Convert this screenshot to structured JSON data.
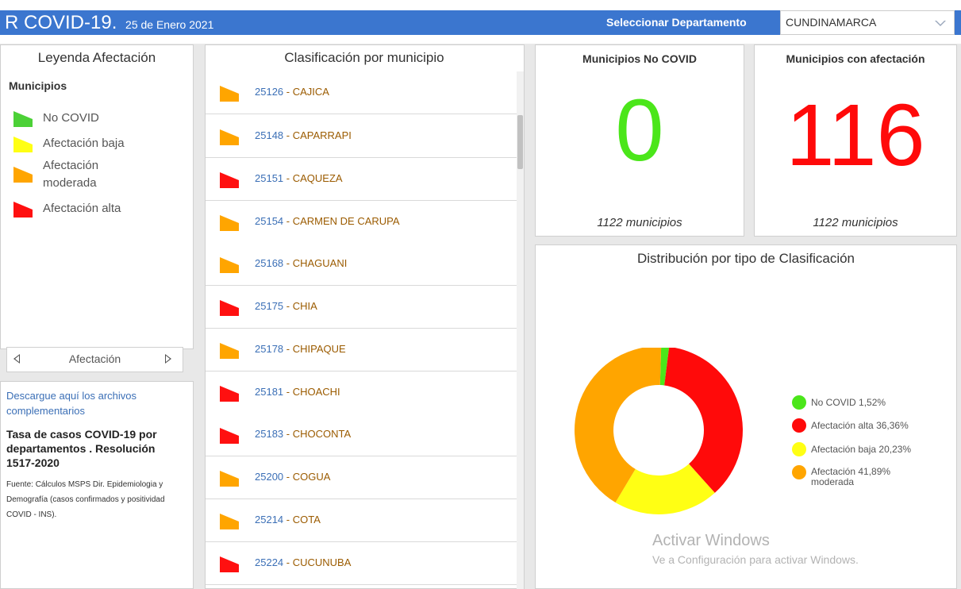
{
  "header": {
    "title": "R COVID-19.",
    "date": "25 de Enero 2021",
    "dept_label": "Seleccionar Departamento",
    "dept_value": "CUNDINAMARCA"
  },
  "legend": {
    "title": "Leyenda Afectación",
    "subtitle": "Municipios",
    "items": [
      {
        "label": "No COVID",
        "color": "#4cd137"
      },
      {
        "label": "Afectación baja",
        "color": "#ffff14"
      },
      {
        "label": "Afectación\nmoderada",
        "color": "#ffa500"
      },
      {
        "label": "Afectación alta",
        "color": "#ff1010"
      }
    ],
    "nav_label": "Afectación"
  },
  "info": {
    "download_link": "Descargue aquí los archivos complementarios",
    "tasa": "Tasa de casos COVID-19 por departamentos . Resolución 1517-2020",
    "fuente": "Fuente: Cálculos MSPS Dir. Epidemiologia y Demografía (casos confirmados y positividad COVID - INS)."
  },
  "list": {
    "title": "Clasificación por municipio",
    "rows": [
      {
        "code": "25126",
        "name": "CAJICA",
        "level": "moderada"
      },
      {
        "code": "25148",
        "name": "CAPARRAPI",
        "level": "moderada"
      },
      {
        "code": "25151",
        "name": "CAQUEZA",
        "level": "alta"
      },
      {
        "code": "25154",
        "name": "CARMEN DE CARUPA",
        "level": "moderada"
      },
      {
        "code": "25168",
        "name": "CHAGUANI",
        "level": "moderada"
      },
      {
        "code": "25175",
        "name": "CHIA",
        "level": "alta"
      },
      {
        "code": "25178",
        "name": "CHIPAQUE",
        "level": "moderada"
      },
      {
        "code": "25181",
        "name": "CHOACHI",
        "level": "alta"
      },
      {
        "code": "25183",
        "name": "CHOCONTA",
        "level": "alta"
      },
      {
        "code": "25200",
        "name": "COGUA",
        "level": "moderada"
      },
      {
        "code": "25214",
        "name": "COTA",
        "level": "moderada"
      },
      {
        "code": "25224",
        "name": "CUCUNUBA",
        "level": "alta"
      }
    ],
    "level_colors": {
      "moderada": "#ffa500",
      "alta": "#ff1010",
      "baja": "#ffff14",
      "no": "#4cd137"
    }
  },
  "indicators": {
    "no_covid": {
      "title": "Municipios No COVID",
      "value": "0",
      "footer": "1122 municipios",
      "color": "#4be61a"
    },
    "afectacion": {
      "title": "Municipios con afectación",
      "value": "116",
      "footer": "1122 municipios",
      "color": "#ff0a0a"
    }
  },
  "distribution": {
    "title": "Distribución por tipo de Clasificación",
    "legend": [
      {
        "name": "No COVID",
        "pct": "1,52%",
        "color": "#4be61a"
      },
      {
        "name": "Afectación alta",
        "pct": "36,36%",
        "color": "#ff0a0a"
      },
      {
        "name": "Afectación baja",
        "pct": "20,23%",
        "color": "#ffff14"
      },
      {
        "name": "Afectación moderada",
        "pct": "41,89%",
        "color": "#ffa500"
      }
    ]
  },
  "chart_data": {
    "type": "pie",
    "title": "Distribución por tipo de Clasificación",
    "categories": [
      "No COVID",
      "Afectación alta",
      "Afectación baja",
      "Afectación moderada"
    ],
    "values": [
      1.52,
      36.36,
      20.23,
      41.89
    ],
    "colors": [
      "#4be61a",
      "#ff0a0a",
      "#ffff14",
      "#ffa500"
    ],
    "legend_position": "right"
  },
  "watermark": {
    "line1": "Activar Windows",
    "line2": "Ve a Configuración para activar Windows."
  }
}
